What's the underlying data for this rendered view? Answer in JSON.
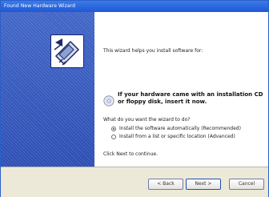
{
  "window": {
    "title": "Found New Hardware Wizard"
  },
  "icons": {
    "wizard": "hardware-wizard-icon",
    "cd": "cd-icon"
  },
  "content": {
    "intro": "This wizard helps you install software for:",
    "insert_line1": "If your hardware came with an installation CD",
    "insert_line2": "or floppy disk, insert it now.",
    "question": "What do you want the wizard to do?",
    "options": [
      {
        "label": "Install the software automatically (Recommended)",
        "checked": true
      },
      {
        "label": "Install from a list or specific location (Advanced)",
        "checked": false
      }
    ],
    "continue": "Click Next to continue."
  },
  "buttons": {
    "back": "< Back",
    "next": "Next >",
    "cancel": "Cancel"
  }
}
